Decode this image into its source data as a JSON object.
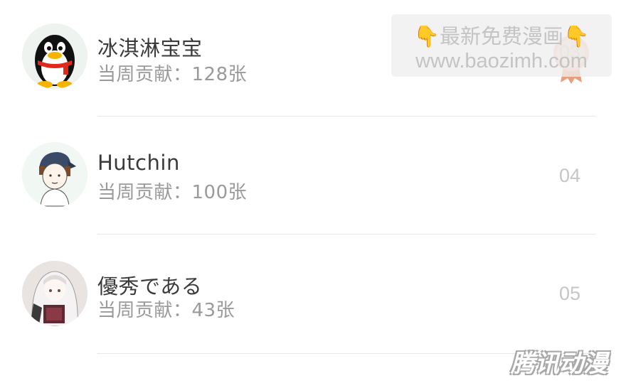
{
  "list": [
    {
      "name": "冰淇淋宝宝",
      "contribution": "当周贡献：128张",
      "rank": "03",
      "avatar": "qq-penguin-avatar"
    },
    {
      "name": "Hutchin",
      "contribution": "当周贡献：100张",
      "rank": "04",
      "avatar": "boy-cap-avatar"
    },
    {
      "name": "優秀である",
      "contribution": "当周贡献：43张",
      "rank": "05",
      "avatar": "anime-girl-avatar"
    }
  ],
  "watermark": {
    "line1": "最新免费漫画",
    "line2": "www.baozimh.com",
    "icon": "pointing-down-hand"
  },
  "brand_logo": "腾讯动漫",
  "colors": {
    "name": "#3a3a3a",
    "contribution": "#9a9a9a",
    "rank": "#c6c6c6",
    "divider": "#e8e8e8",
    "medal": "#e8a07c"
  }
}
